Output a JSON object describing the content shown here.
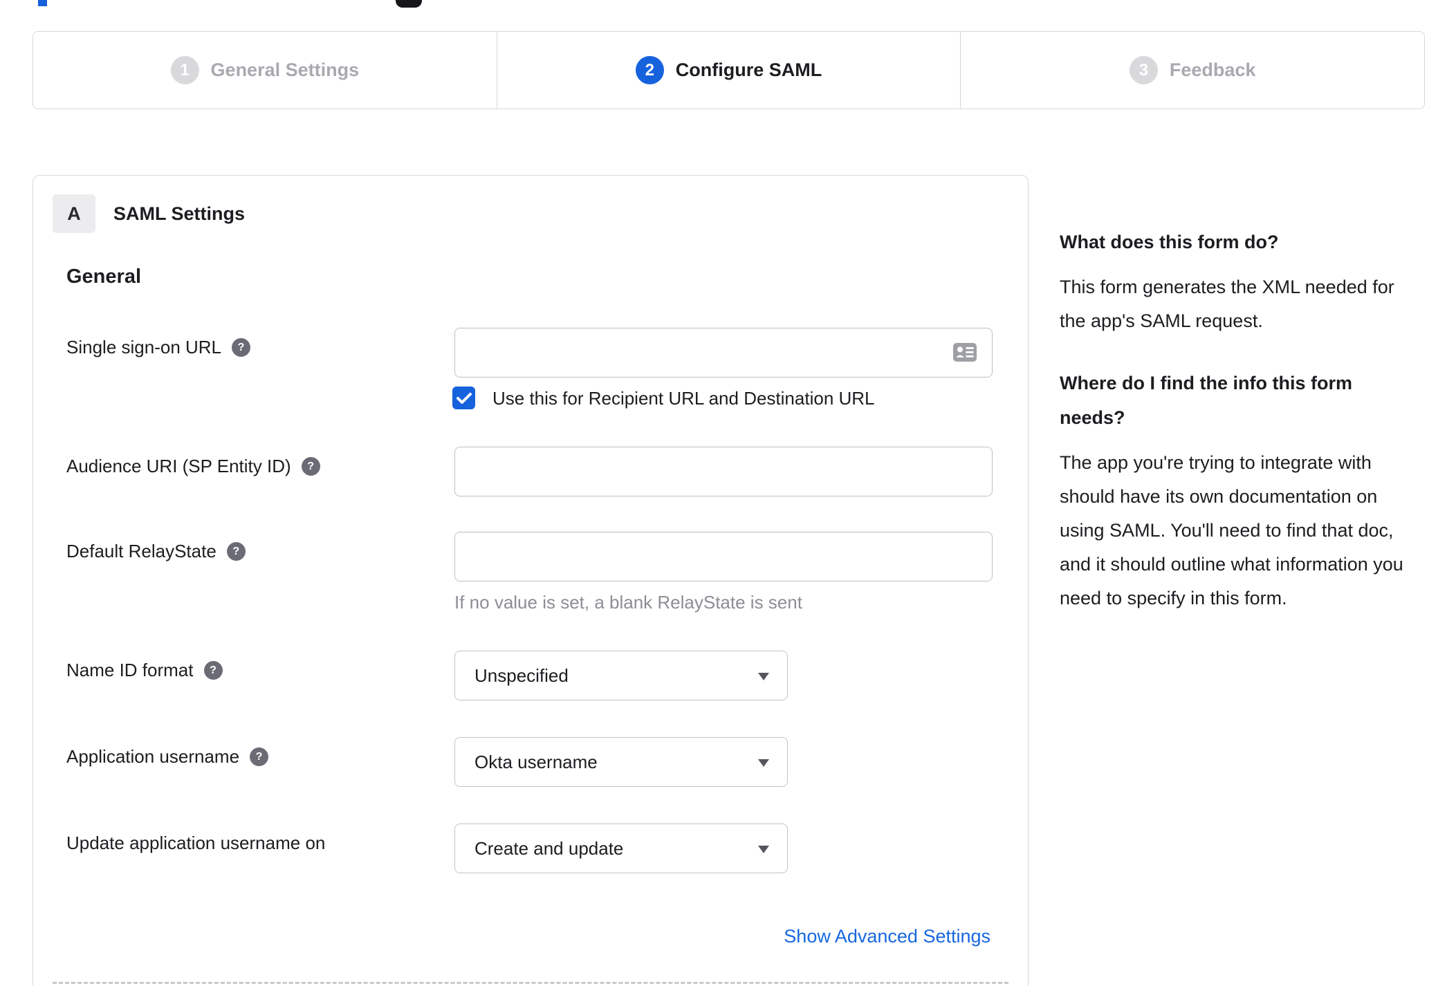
{
  "stepper": {
    "steps": [
      {
        "number": "1",
        "label": "General Settings",
        "state": "inactive"
      },
      {
        "number": "2",
        "label": "Configure SAML",
        "state": "active"
      },
      {
        "number": "3",
        "label": "Feedback",
        "state": "inactive"
      }
    ]
  },
  "panel": {
    "section_badge": "A",
    "section_title": "SAML Settings",
    "group_heading": "General",
    "fields": {
      "sso_url": {
        "label": "Single sign-on URL",
        "value": "",
        "has_help": true
      },
      "sso_checkbox": {
        "label": "Use this for Recipient URL and Destination URL",
        "checked": true
      },
      "audience_uri": {
        "label": "Audience URI (SP Entity ID)",
        "value": "",
        "has_help": true
      },
      "default_relaystate": {
        "label": "Default RelayState",
        "value": "",
        "has_help": true,
        "helper": "If no value is set, a blank RelayState is sent"
      },
      "name_id_format": {
        "label": "Name ID format",
        "value": "Unspecified",
        "has_help": true
      },
      "application_username": {
        "label": "Application username",
        "value": "Okta username",
        "has_help": true
      },
      "update_app_username_on": {
        "label": "Update application username on",
        "value": "Create and update",
        "has_help": false
      }
    },
    "advanced_link": "Show Advanced Settings"
  },
  "sidebar": {
    "sections": [
      {
        "heading": "What does this form do?",
        "body": "This form generates the XML needed for the app's SAML request."
      },
      {
        "heading": "Where do I find the info this form needs?",
        "body": "The app you're trying to integrate with should have its own documentation on using SAML. You'll need to find that doc, and it should outline what information you need to specify in this form."
      }
    ]
  },
  "icons": {
    "help_glyph": "?"
  },
  "colors": {
    "accent_blue": "#1662dd",
    "inactive_step_grey": "#d9d9dc",
    "text_dark": "#1d1d21",
    "muted_text": "#8d8d95",
    "border_grey": "#d8d8da"
  }
}
